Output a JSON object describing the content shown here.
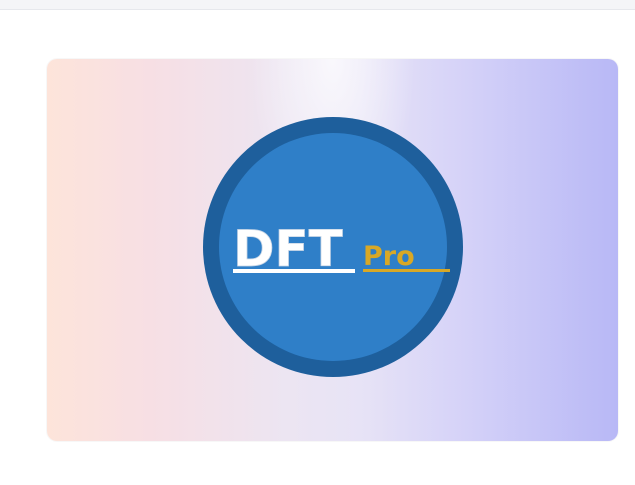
{
  "logo": {
    "primary_text": "DFT",
    "secondary_text": "Pro",
    "colors": {
      "outer_ring": "#1e5f9c",
      "inner_circle": "#2f7fc8",
      "primary_text": "#ffffff",
      "secondary_text": "#d8a826"
    }
  },
  "card": {
    "gradient_colors": [
      "#fde4da",
      "#e7e3f6",
      "#b8b8f6"
    ]
  }
}
